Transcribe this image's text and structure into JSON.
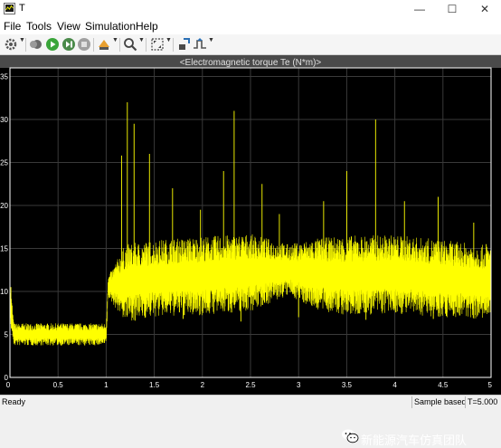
{
  "window": {
    "title": "T"
  },
  "menu": [
    "File",
    "Tools",
    "View",
    "Simulation",
    "Help"
  ],
  "toolbar": {
    "icons": [
      "gear-icon",
      "restore-icon",
      "run-icon",
      "step-forward-icon",
      "stop-icon",
      "highlight-icon",
      "zoom-icon",
      "fit-to-view-icon",
      "cursor-measure-icon",
      "triggers-icon"
    ]
  },
  "plot": {
    "title": "<Electromagnetic torque Te (N*m)>",
    "y_ticks": [
      "0",
      "5",
      "10",
      "15",
      "20",
      "25",
      "30",
      "35"
    ],
    "x_ticks": [
      "0",
      "0.5",
      "1",
      "1.5",
      "2",
      "2.5",
      "3",
      "3.5",
      "4",
      "4.5",
      "5"
    ],
    "line_color": "#ffff00"
  },
  "chart_data": {
    "type": "line",
    "title": "<Electromagnetic torque Te (N*m)>",
    "xlabel": "",
    "ylabel": "",
    "xlim": [
      0,
      5
    ],
    "ylim": [
      0,
      36
    ],
    "grid": true,
    "series": [
      {
        "band_x": [
          0.0,
          0.02,
          0.04,
          1.0,
          1.02,
          1.2,
          1.5,
          2.0,
          2.5,
          2.9,
          3.2,
          3.5,
          4.0,
          4.5,
          5.0
        ],
        "band_center": [
          8.5,
          7.0,
          5.0,
          5.0,
          10.5,
          11.0,
          11.5,
          11.8,
          12.2,
          12.5,
          12.0,
          11.8,
          12.0,
          11.5,
          11.0
        ],
        "band_half_width": [
          2.5,
          2.0,
          1.3,
          1.3,
          1.2,
          4.5,
          4.5,
          4.6,
          4.5,
          3.0,
          4.2,
          4.7,
          4.6,
          4.5,
          4.3
        ],
        "spikes": [
          [
            0.01,
            10.5
          ],
          [
            1.16,
            25.8
          ],
          [
            1.22,
            32.0
          ],
          [
            1.29,
            29.5
          ],
          [
            1.45,
            26.0
          ],
          [
            1.69,
            22.0
          ],
          [
            1.98,
            19.5
          ],
          [
            2.22,
            24.0
          ],
          [
            2.33,
            31.0
          ],
          [
            2.62,
            22.5
          ],
          [
            2.8,
            19.0
          ],
          [
            3.26,
            20.5
          ],
          [
            3.5,
            24.0
          ],
          [
            3.8,
            30.0
          ],
          [
            4.1,
            20.5
          ],
          [
            4.45,
            21.0
          ],
          [
            4.82,
            18.0
          ],
          [
            4.95,
            15.5
          ],
          [
            1.3,
            6.6
          ],
          [
            1.8,
            6.8
          ],
          [
            2.4,
            6.5
          ],
          [
            3.0,
            7.0
          ],
          [
            3.7,
            6.7
          ],
          [
            4.4,
            6.8
          ]
        ]
      }
    ]
  },
  "status": {
    "state": "Ready",
    "mode": "Sample based",
    "time": "T=5.000"
  },
  "watermark": {
    "text": "新能源汽车仿真团队"
  },
  "colors": {
    "plot_bg": "#000000",
    "axis": "#ffffff",
    "grid": "#3a3a3a",
    "trace": "#ffff00",
    "title_bar": "#4a4a4a"
  }
}
